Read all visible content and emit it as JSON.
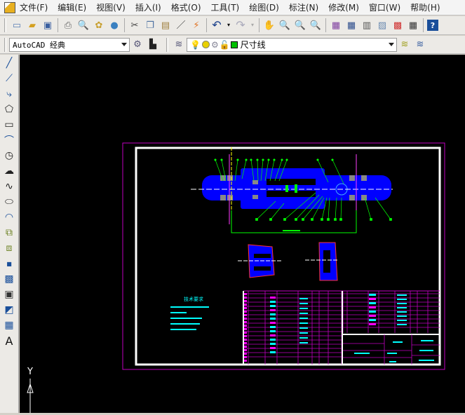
{
  "menu": [
    "文件(F)",
    "编辑(E)",
    "视图(V)",
    "插入(I)",
    "格式(O)",
    "工具(T)",
    "绘图(D)",
    "标注(N)",
    "修改(M)",
    "窗口(W)",
    "帮助(H)"
  ],
  "toolbar1": {
    "icons": [
      "new-icon",
      "open-icon",
      "save-icon",
      "print-icon",
      "print-preview-icon",
      "publish-icon",
      "3d-dwf-icon",
      "cut-icon",
      "copy-icon",
      "paste-icon",
      "match-properties-icon",
      "block-editor-icon",
      "undo-icon",
      "redo-icon",
      "pan-icon",
      "zoom-realtime-icon",
      "zoom-window-icon",
      "zoom-previous-icon",
      "properties-icon",
      "design-center-icon",
      "tool-palettes-icon",
      "sheet-set-icon",
      "markup-icon",
      "calculator-icon",
      "help-icon"
    ]
  },
  "toolbar2": {
    "workspace": "AutoCAD 经典",
    "layer": "尺寸线",
    "layer_color": "#00c000"
  },
  "draw_tools": [
    "line-icon",
    "construction-line-icon",
    "polyline-icon",
    "polygon-icon",
    "rectangle-icon",
    "arc-icon",
    "circle-icon",
    "revision-cloud-icon",
    "spline-icon",
    "ellipse-icon",
    "ellipse-arc-icon",
    "insert-block-icon",
    "make-block-icon",
    "point-icon",
    "hatch-icon",
    "gradient-icon",
    "region-icon",
    "table-icon",
    "multiline-text-icon"
  ],
  "drawing": {
    "tech_title": "技术要求",
    "ucs_y": "Y",
    "colors": {
      "part": "#0000ff",
      "leader": "#00ff00",
      "table": "#ff00ff",
      "text": "#00ffff",
      "center": "#ffff00"
    }
  }
}
